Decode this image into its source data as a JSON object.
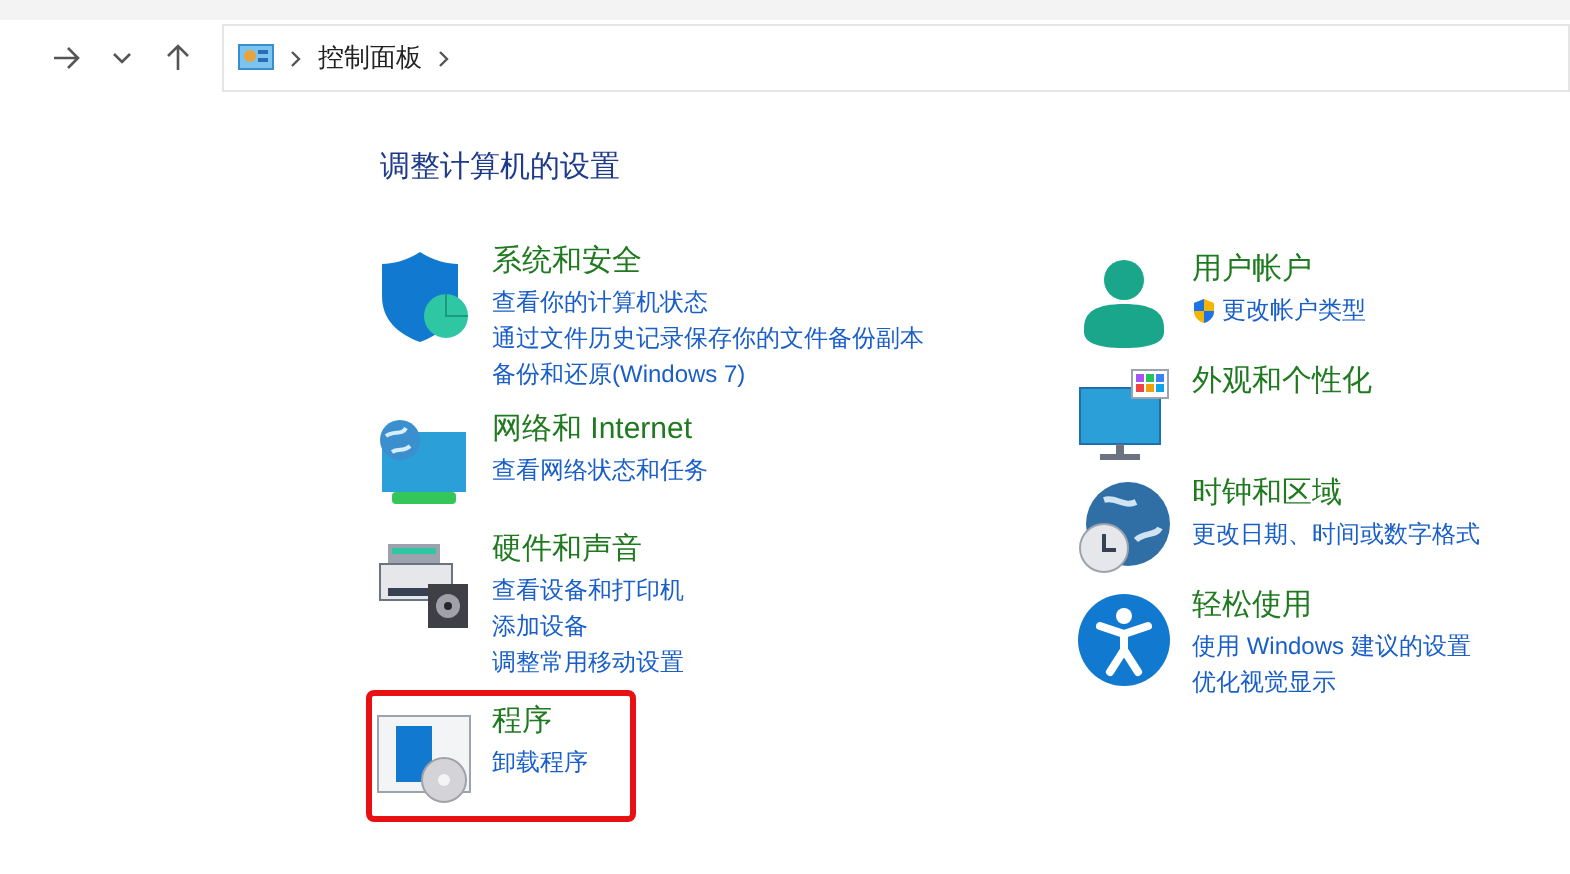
{
  "nav": {
    "breadcrumb": [
      "控制面板"
    ]
  },
  "heading": "调整计算机的设置",
  "columns": [
    [
      {
        "kind": "security",
        "title": "系统和安全",
        "highlighted": false,
        "links": [
          {
            "text": "查看你的计算机状态",
            "shield": false
          },
          {
            "text": "通过文件历史记录保存你的文件备份副本",
            "shield": false
          },
          {
            "text": "备份和还原(Windows 7)",
            "shield": false
          }
        ]
      },
      {
        "kind": "network",
        "title": "网络和 Internet",
        "highlighted": false,
        "links": [
          {
            "text": "查看网络状态和任务",
            "shield": false
          }
        ]
      },
      {
        "kind": "hardware",
        "title": "硬件和声音",
        "highlighted": false,
        "links": [
          {
            "text": "查看设备和打印机",
            "shield": false
          },
          {
            "text": "添加设备",
            "shield": false
          },
          {
            "text": "调整常用移动设置",
            "shield": false
          }
        ]
      },
      {
        "kind": "programs",
        "title": "程序",
        "highlighted": true,
        "links": [
          {
            "text": "卸载程序",
            "shield": false
          }
        ]
      }
    ],
    [
      {
        "kind": "user",
        "title": "用户帐户",
        "highlighted": false,
        "links": [
          {
            "text": "更改帐户类型",
            "shield": true
          }
        ]
      },
      {
        "kind": "appearance",
        "title": "外观和个性化",
        "highlighted": false
      },
      {
        "kind": "clock",
        "title": "时钟和区域",
        "highlighted": false,
        "links": [
          {
            "text": "更改日期、时间或数字格式",
            "shield": false
          }
        ]
      },
      {
        "kind": "access",
        "title": "轻松使用",
        "highlighted": false,
        "links": [
          {
            "text": "使用 Windows 建议的设置",
            "shield": false
          },
          {
            "text": "优化视觉显示",
            "shield": false
          }
        ]
      }
    ]
  ]
}
